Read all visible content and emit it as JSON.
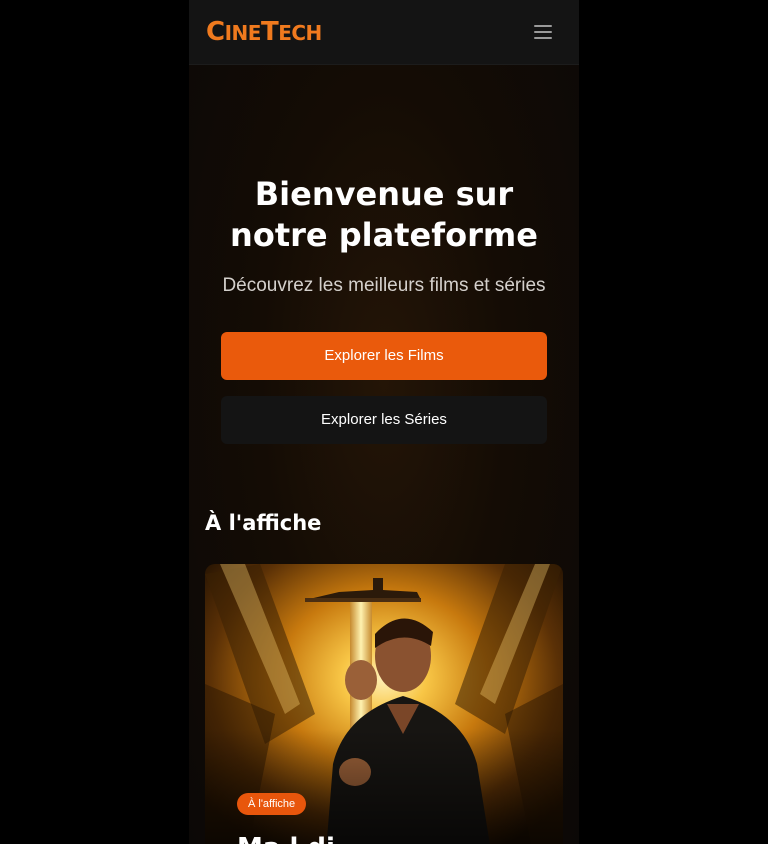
{
  "app": {
    "logo": "CINETECH",
    "logo_parts": [
      "C",
      "INE",
      "T",
      "ECH"
    ]
  },
  "header": {
    "menu_icon": "hamburger-menu-icon"
  },
  "hero": {
    "title": "Bienvenue sur notre plateforme",
    "subtitle": "Découvrez les meilleurs films et séries",
    "primary_button": "Explorer les Films",
    "secondary_button": "Explorer les Séries"
  },
  "featured": {
    "section_title": "À l'affiche",
    "card": {
      "badge": "À l'affiche",
      "title_partial": "Ma    l    di"
    }
  },
  "colors": {
    "accent": "#ea5a0c",
    "logo": "#f07a1e",
    "navbar": "#141414",
    "background": "#000000",
    "secondary_button": "#141414"
  }
}
